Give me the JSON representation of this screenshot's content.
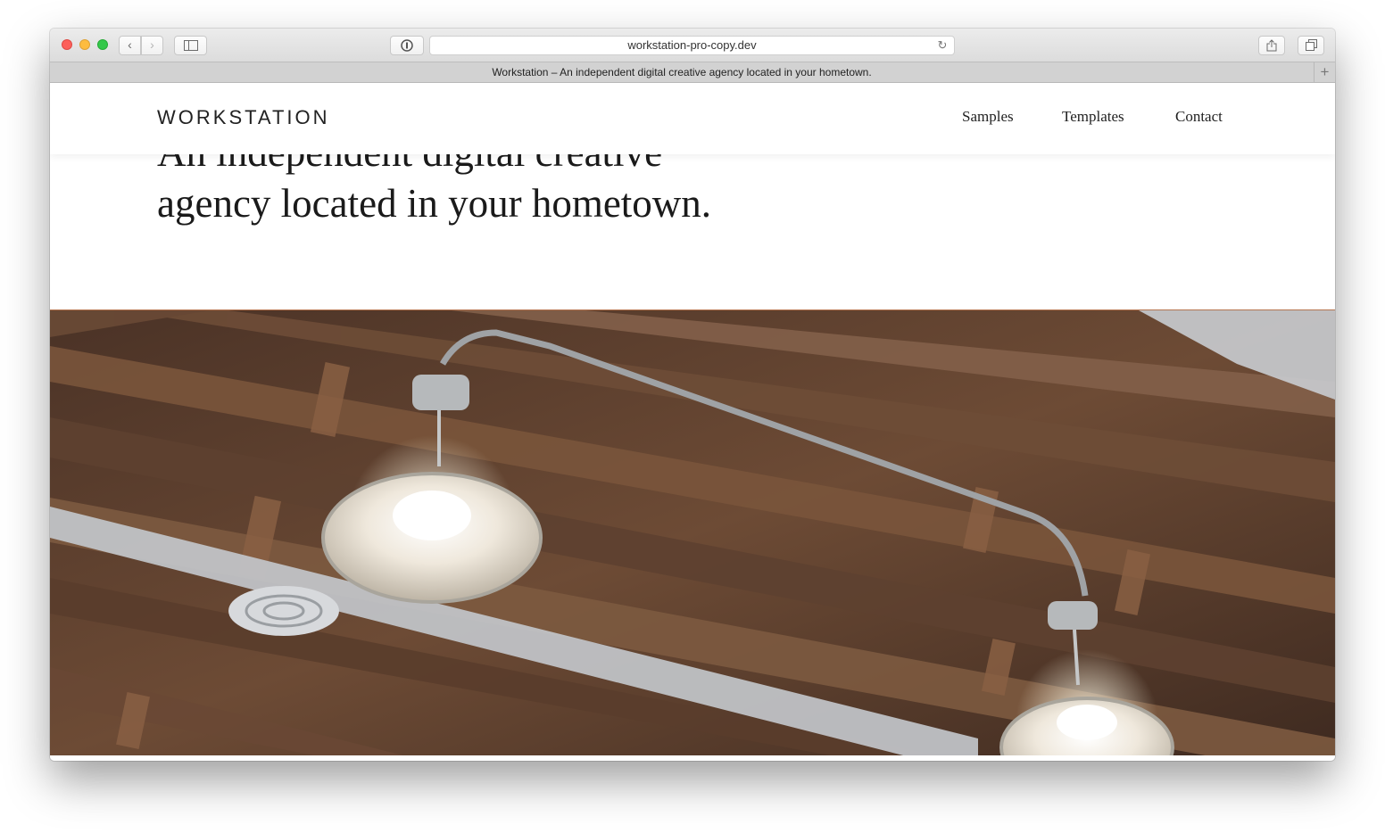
{
  "browser": {
    "url": "workstation-pro-copy.dev",
    "tab_title": "Workstation – An independent digital creative agency located in your hometown.",
    "back_icon": "‹",
    "forward_icon": "›",
    "reload_icon": "↻",
    "new_tab_icon": "+"
  },
  "site": {
    "logo": "WORKSTATION",
    "nav": {
      "samples": "Samples",
      "templates": "Templates",
      "contact": "Contact"
    },
    "hero": {
      "line1": "An independent digital creative",
      "line2": "agency located in your hometown."
    }
  },
  "colors": {
    "accent_border": "#b5744f",
    "wood": "#6b4a34"
  }
}
